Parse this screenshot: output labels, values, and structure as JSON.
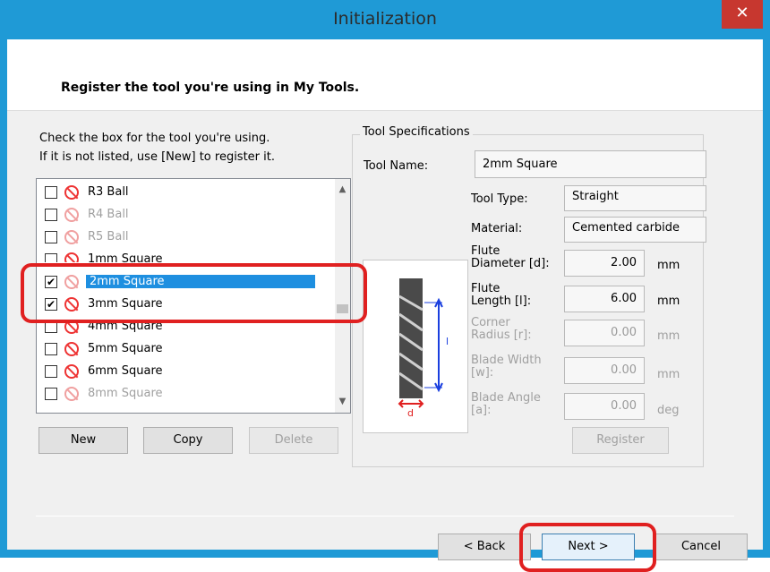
{
  "window": {
    "title": "Initialization",
    "close_glyph": "✕"
  },
  "header": {
    "text": "Register the tool you're using in My Tools."
  },
  "instructions": {
    "line1": "Check the box for the tool you're using.",
    "line2": "If it is not listed, use [New] to register it."
  },
  "tools": [
    {
      "label": "R3 Ball",
      "checked": false,
      "enabled": true
    },
    {
      "label": "R4 Ball",
      "checked": false,
      "enabled": false
    },
    {
      "label": "R5 Ball",
      "checked": false,
      "enabled": false
    },
    {
      "label": "1mm Square",
      "checked": false,
      "enabled": true
    },
    {
      "label": "2mm Square",
      "checked": true,
      "enabled": false,
      "selected": true
    },
    {
      "label": "3mm Square",
      "checked": true,
      "enabled": true
    },
    {
      "label": "4mm Square",
      "checked": false,
      "enabled": true
    },
    {
      "label": "5mm Square",
      "checked": false,
      "enabled": true
    },
    {
      "label": "6mm Square",
      "checked": false,
      "enabled": true
    },
    {
      "label": "8mm Square",
      "checked": false,
      "enabled": false
    }
  ],
  "list_buttons": {
    "new": "New",
    "copy": "Copy",
    "delete": "Delete"
  },
  "specs": {
    "group_title": "Tool Specifications",
    "tool_name_label": "Tool Name:",
    "tool_name": "2mm Square",
    "tool_type_label": "Tool Type:",
    "tool_type": "Straight",
    "material_label": "Material:",
    "material": "Cemented carbide",
    "flute_diameter_label1": "Flute",
    "flute_diameter_label2": "Diameter [d]:",
    "flute_diameter": "2.00",
    "flute_length_label1": "Flute",
    "flute_length_label2": "Length [l]:",
    "flute_length": "6.00",
    "corner_radius_label1": "Corner",
    "corner_radius_label2": "Radius [r]:",
    "corner_radius": "0.00",
    "blade_width_label1": "Blade Width",
    "blade_width_label2": "[w]:",
    "blade_width": "0.00",
    "blade_angle_label1": "Blade Angle",
    "blade_angle_label2": "[a]:",
    "blade_angle": "0.00",
    "unit_mm": "mm",
    "unit_deg": "deg",
    "register": "Register",
    "diagram_d": "d",
    "diagram_l": "l"
  },
  "footer": {
    "back": "< Back",
    "next": "Next >",
    "cancel": "Cancel"
  },
  "colors": {
    "title_bar": "#1f9ad6",
    "selection": "#1e8fe0",
    "highlight": "#e02020",
    "close": "#c7372f"
  }
}
